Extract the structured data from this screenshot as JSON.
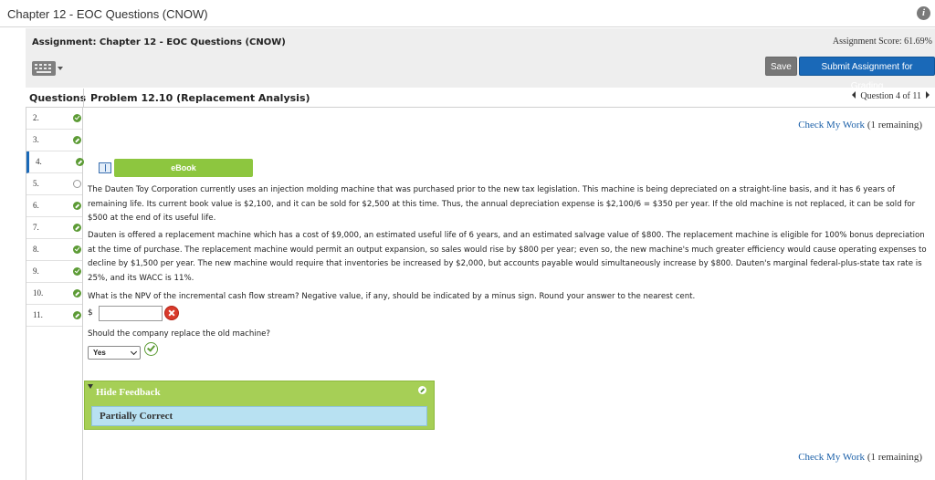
{
  "window": {
    "title": "Chapter 12 - EOC Questions (CNOW)",
    "info_icon": "info-icon"
  },
  "assignment": {
    "title": "Assignment: Chapter 12 - EOC Questions (CNOW)",
    "score": "Assignment Score: 61.69%",
    "save_label": "Save",
    "submit_label": "Submit Assignment for Grading",
    "keyboard_icon": "keyboard-icon"
  },
  "sidebar": {
    "header": "Questions",
    "items": [
      {
        "num": "2.",
        "status": "complete"
      },
      {
        "num": "3.",
        "status": "partial"
      },
      {
        "num": "4.",
        "status": "partial",
        "current": true
      },
      {
        "num": "5.",
        "status": "not-attempted"
      },
      {
        "num": "6.",
        "status": "partial"
      },
      {
        "num": "7.",
        "status": "partial"
      },
      {
        "num": "8.",
        "status": "complete"
      },
      {
        "num": "9.",
        "status": "complete"
      },
      {
        "num": "10.",
        "status": "partial"
      },
      {
        "num": "11.",
        "status": "partial"
      }
    ]
  },
  "problem": {
    "title": "Problem 12.10 (Replacement Analysis)",
    "nav": "Question 4 of 11",
    "check_label": "Check My Work",
    "check_remaining": "(1 remaining)",
    "ebook_label": "eBook",
    "para1": "The Dauten Toy Corporation currently uses an injection molding machine that was purchased prior to the new tax legislation. This machine is being depreciated on a straight-line basis, and it has 6 years of remaining life. Its current book value is $2,100, and it can be sold for $2,500 at this time. Thus, the annual depreciation expense is $2,100/6 = $350 per year. If the old machine is not replaced, it can be sold for $500 at the end of its useful life.",
    "para2": "Dauten is offered a replacement machine which has a cost of $9,000, an estimated useful life of 6 years, and an estimated salvage value of $800. The replacement machine is eligible for 100% bonus depreciation at the time of purchase. The replacement machine would permit an output expansion, so sales would rise by $800 per year; even so, the new machine's much greater efficiency would cause operating expenses to decline by $1,500 per year. The new machine would require that inventories be increased by $2,000, but accounts payable would simultaneously increase by $800. Dauten's marginal federal-plus-state tax rate is 25%, and its WACC is 11%.",
    "question1": "What is the NPV of the incremental cash flow stream? Negative value, if any, should be indicated by a minus sign. Round your answer to the nearest cent.",
    "currency": "$",
    "npv_value": "",
    "question2": "Should the company replace the old machine?",
    "replace_answer": "Yes"
  },
  "feedback": {
    "toggle_label": "Hide Feedback",
    "result": "Partially Correct"
  },
  "colors": {
    "accent_blue": "#1a69b8",
    "green": "#8dc63f",
    "correct": "#5c9b35",
    "incorrect": "#d93a2b"
  }
}
